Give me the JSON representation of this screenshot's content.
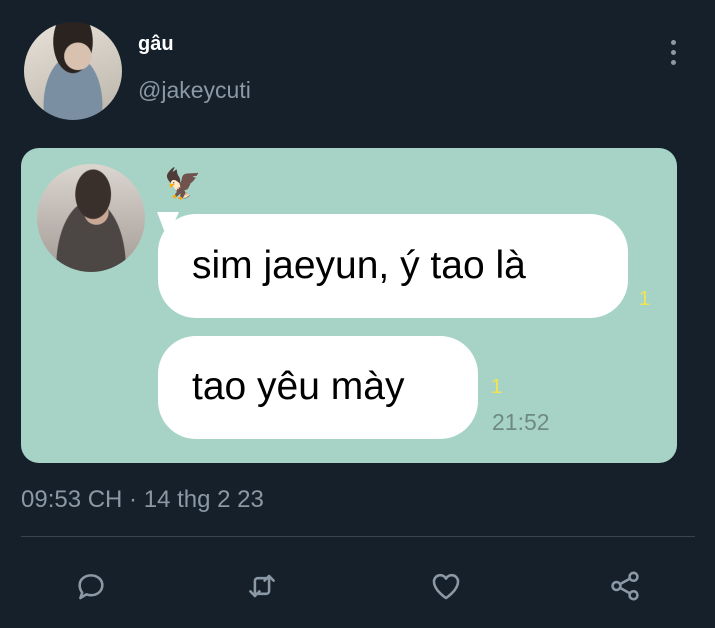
{
  "user": {
    "display_name": "gâu",
    "handle": "@jakeycuti"
  },
  "media": {
    "messages": [
      {
        "text": "sim jaeyun, ý tao là",
        "read_count": "1"
      },
      {
        "text": "tao yêu mày",
        "read_count": "1",
        "time": "21:52"
      }
    ],
    "sticker": "🦅",
    "background_color": "#a7d3c6",
    "read_marker_color": "#f2e54d"
  },
  "meta": {
    "timestamp": "09:53 CH · 14 thg 2 23"
  },
  "actions": {
    "reply_icon": "reply-icon",
    "retweet_icon": "retweet-icon",
    "like_icon": "heart-icon",
    "share_icon": "share-icon"
  },
  "colors": {
    "background": "#15202b",
    "secondary_text": "#8b98a5",
    "divider": "#38444d"
  }
}
